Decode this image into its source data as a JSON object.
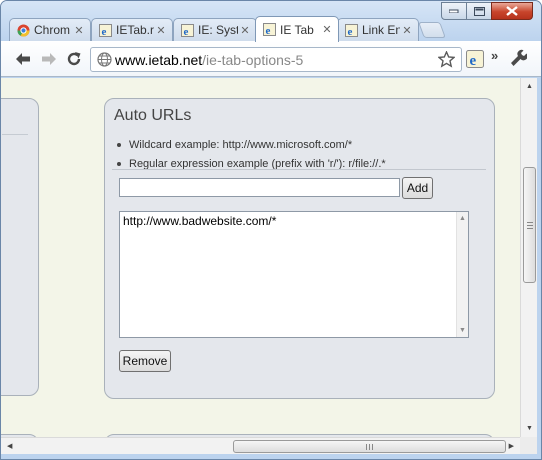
{
  "browser": {
    "tabs": [
      {
        "title": "Chrom",
        "favicon": "chrome-icon",
        "active": false
      },
      {
        "title": "IETab.r",
        "favicon": "ie-icon",
        "active": false
      },
      {
        "title": "IE: Syst",
        "favicon": "ie-icon",
        "active": false
      },
      {
        "title": "IE Tab",
        "favicon": "ie-icon",
        "active": true
      },
      {
        "title": "Link En",
        "favicon": "ie-icon",
        "active": false
      }
    ],
    "address": {
      "host": "www.ietab.net",
      "path": "/ie-tab-options-5"
    },
    "overflow_label": "»"
  },
  "page": {
    "panel_title": "Auto URLs",
    "bullets": [
      "Wildcard example: http://www.microsoft.com/*",
      "Regular expression example (prefix with 'r/'): r/file://.*"
    ],
    "url_input_value": "",
    "add_label": "Add",
    "list_entries": [
      "http://www.badwebsite.com/*"
    ],
    "remove_label": "Remove"
  }
}
